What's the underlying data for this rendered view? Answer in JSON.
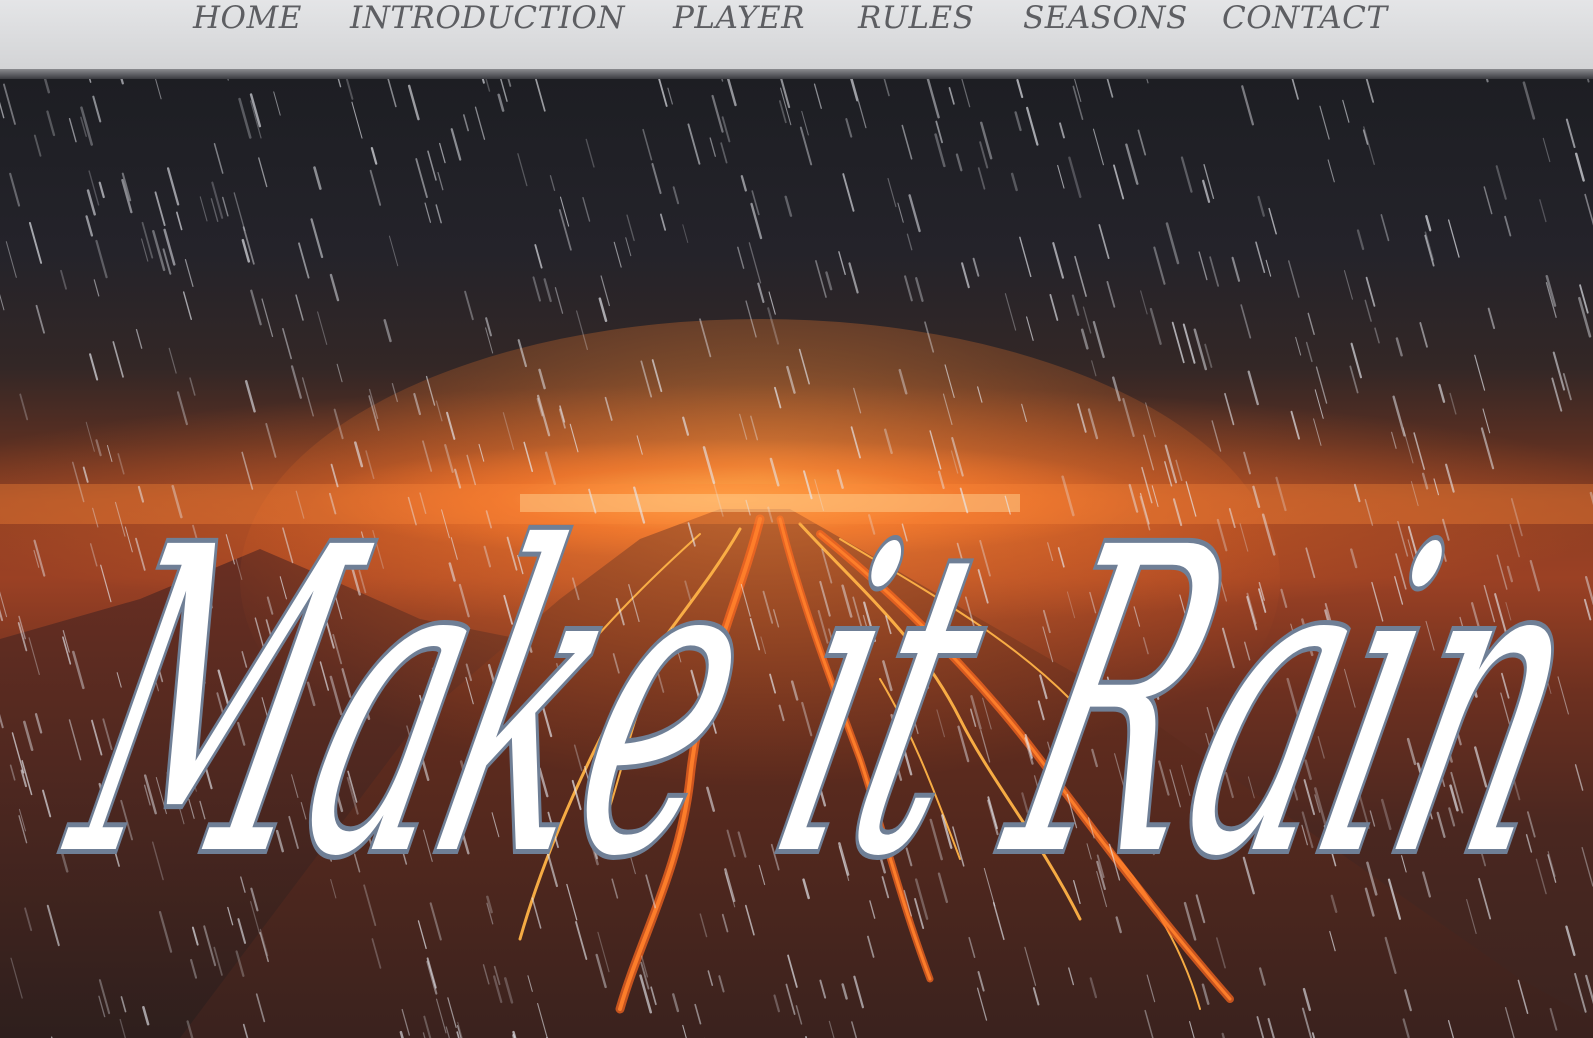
{
  "nav": {
    "items": [
      {
        "label": "HOME"
      },
      {
        "label": "INTRODUCTION"
      },
      {
        "label": "PLAYER"
      },
      {
        "label": "RULES"
      },
      {
        "label": "SEASONS"
      },
      {
        "label": "CONTACT"
      }
    ]
  },
  "hero": {
    "logo_text": "Make it Rain"
  },
  "colors": {
    "nav_background": "#dcdddf",
    "nav_text": "#5d5e62",
    "logo_fill": "#ffffff",
    "logo_outline": "#6f7f96",
    "lava": "#e8632a"
  }
}
